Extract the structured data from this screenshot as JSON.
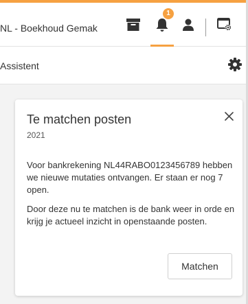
{
  "topbar": {
    "org_name": "NL - Boekhoud Gemak",
    "notification_count": "1",
    "icons": [
      "archive-icon",
      "bell-icon",
      "user-icon",
      "screen-settings-icon"
    ],
    "accent_color": "#f6a141"
  },
  "assistant": {
    "title": "Assistent",
    "settings_icon": "gear-icon"
  },
  "card": {
    "title": "Te matchen posten",
    "year": "2021",
    "paragraph1": "Voor bankrekening NL44RABO0123456789 hebben we nieuwe mutaties ontvangen. Er staan er nog 7 open.",
    "paragraph2": "Door deze nu te matchen is de bank weer in orde en krijg je actueel inzicht in openstaande posten.",
    "action_label": "Matchen",
    "close_icon": "close-icon"
  }
}
